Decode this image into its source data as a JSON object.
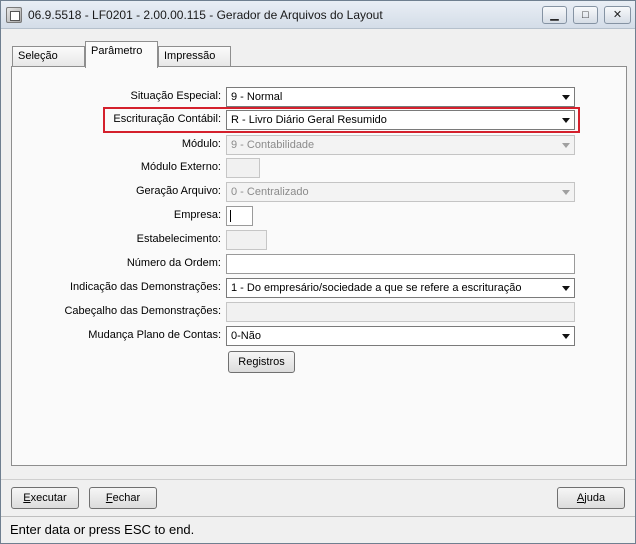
{
  "window": {
    "title": "06.9.5518 - LF0201 - 2.00.00.115 - Gerador de Arquivos do Layout",
    "min_glyph": "▁",
    "max_glyph": "□",
    "close_glyph": "✕"
  },
  "tabs": [
    {
      "label": "Seleção"
    },
    {
      "label": "Parâmetro"
    },
    {
      "label": "Impressão"
    }
  ],
  "form": {
    "situacao_especial": {
      "label": "Situação Especial:",
      "value": "9 - Normal"
    },
    "escrituracao_contabil": {
      "label": "Escrituração Contábil:",
      "value": "R - Livro Diário Geral Resumido"
    },
    "modulo": {
      "label": "Módulo:",
      "value": "9 - Contabilidade"
    },
    "modulo_externo": {
      "label": "Módulo Externo:",
      "value": ""
    },
    "geracao_arquivo": {
      "label": "Geração Arquivo:",
      "value": "0 - Centralizado"
    },
    "empresa": {
      "label": "Empresa:",
      "value": ""
    },
    "estabelecimento": {
      "label": "Estabelecimento:",
      "value": ""
    },
    "numero_ordem": {
      "label": "Número da Ordem:",
      "value": ""
    },
    "indicacao_demonstracoes": {
      "label": "Indicação das Demonstrações:",
      "value": "1 - Do empresário/sociedade a que se refere a escrituração"
    },
    "cabecalho_demonstracoes": {
      "label": "Cabeçalho das Demonstrações:",
      "value": ""
    },
    "mudanca_plano_contas": {
      "label": "Mudança Plano de Contas:",
      "value": "0-Não"
    },
    "registros_button": "Registros"
  },
  "footer": {
    "executar_first": "E",
    "executar_rest": "xecutar",
    "fechar_first": "F",
    "fechar_rest": "echar",
    "ajuda_first": "A",
    "ajuda_rest": "juda"
  },
  "status": {
    "text": "Enter data or press ESC to end."
  }
}
